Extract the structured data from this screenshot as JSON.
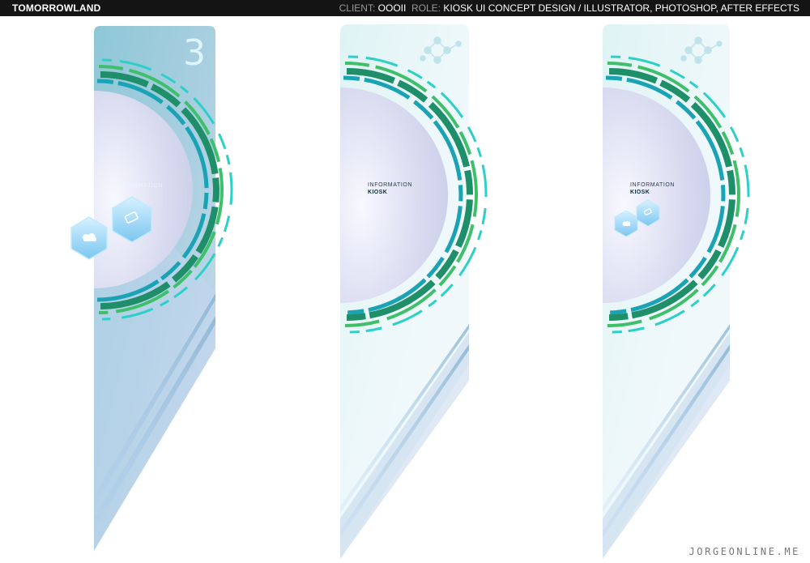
{
  "header": {
    "project": "TOMORROWLAND",
    "client_key": "CLIENT:",
    "client_value": "OOOII",
    "role_key": "ROLE:",
    "role_value": "KIOSK UI CONCEPT DESIGN / ILLUSTRATOR, PHOTOSHOP, AFTER EFFECTS"
  },
  "panels": [
    {
      "badge": "3",
      "label": "INFORMATION",
      "sub": ""
    },
    {
      "badge": "",
      "label": "INFORMATION",
      "sub": "KIOSK"
    },
    {
      "badge": "",
      "label": "INFORMATION",
      "sub": "KIOSK"
    }
  ],
  "credit": "JORGEONLINE.ME",
  "colors": {
    "topbar": "#141414",
    "accent_green": "#3fbf6a",
    "accent_teal": "#1aa3b5",
    "hex_blue": "#8fd4f5"
  },
  "icons": [
    "weather-icon",
    "battery-icon",
    "molecule-logo-icon"
  ]
}
